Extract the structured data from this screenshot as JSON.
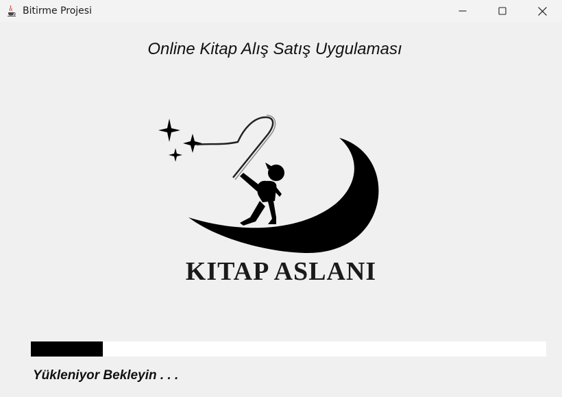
{
  "window": {
    "title": "Bitirme Projesi",
    "app_icon": "java-coffee-icon",
    "controls": [
      "minimize-icon",
      "maximize-icon",
      "close-icon"
    ]
  },
  "main": {
    "heading": "Online Kitap Alış Satış Uygulaması",
    "logo_text": "KITAP ASLANI",
    "logo_icon": "boy-on-crescent-moon-with-stars",
    "progress": {
      "fraction": 0.14
    },
    "status_text": "Yükleniyor Bekleyin . . ."
  },
  "colors": {
    "background": "#f0f0f0",
    "progress_fill": "#000000",
    "progress_track": "#ffffff"
  }
}
